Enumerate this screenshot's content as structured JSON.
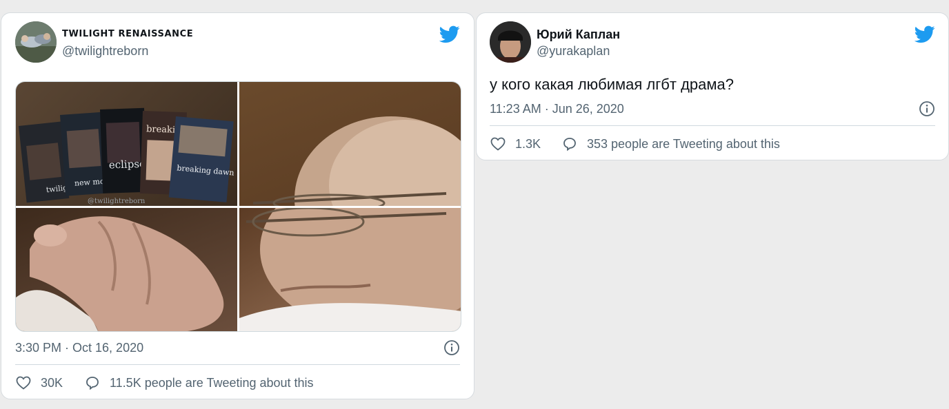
{
  "tweets": [
    {
      "display_name": "TWILIGHT RENAISSANCE",
      "handle": "@twilightreborn",
      "timestamp": "3:30 PM · Oct 16, 2020",
      "likes": "30K",
      "conversation": "11.5K people are Tweeting about this",
      "media": {
        "dvd_titles": [
          "twilight",
          "new moon",
          "eclipse",
          "breaking",
          "breaking dawn"
        ],
        "watermark": "@twilightreborn"
      }
    },
    {
      "display_name": "Юрий Каплан",
      "handle": "@yurakaplan",
      "text": "у кого какая любимая лгбт драма?",
      "timestamp": "11:23 AM · Jun 26, 2020",
      "likes": "1.3K",
      "conversation": "353 people are Tweeting about this"
    }
  ],
  "colors": {
    "twitter_blue": "#1d9bf0",
    "text_primary": "#0f1419",
    "text_secondary": "#536471",
    "background": "#ececec"
  },
  "icons": [
    "twitter-bird-icon",
    "info-icon",
    "heart-icon",
    "reply-bubble-icon"
  ]
}
